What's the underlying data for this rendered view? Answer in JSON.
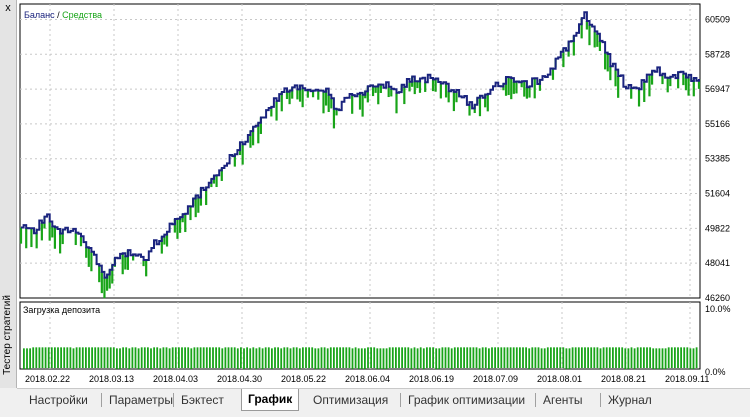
{
  "window": {
    "close_label": "x",
    "side_title": "Тестер стратегий"
  },
  "legend": {
    "balance": "Баланс",
    "separator": " / ",
    "equity": "Средства"
  },
  "colors": {
    "balance": "#1a237e",
    "equity": "#18a418",
    "deposit": "#18a418",
    "grid": "#c8c8c8"
  },
  "deposit_panel": {
    "title": "Загрузка депозита",
    "max_label": "10.0%",
    "min_label": "0.0%"
  },
  "chart_data": {
    "type": "line",
    "title": "",
    "series_names": [
      "Баланс",
      "Средства"
    ],
    "y_ticks": [
      "60509",
      "58728",
      "56947",
      "55166",
      "53385",
      "51604",
      "49822",
      "48041",
      "46260"
    ],
    "ylim": [
      46260,
      61300
    ],
    "x_labels": [
      "2018.02.22",
      "2018.03.13",
      "2018.04.03",
      "2018.04.30",
      "2018.05.22",
      "2018.06.04",
      "2018.06.19",
      "2018.07.09",
      "2018.08.01",
      "2018.08.21",
      "2018.09.11"
    ],
    "balance_curve": [
      [
        0,
        49800
      ],
      [
        0.02,
        49700
      ],
      [
        0.035,
        50500
      ],
      [
        0.045,
        50100
      ],
      [
        0.06,
        49600
      ],
      [
        0.075,
        49900
      ],
      [
        0.09,
        49400
      ],
      [
        0.11,
        48300
      ],
      [
        0.125,
        47300
      ],
      [
        0.14,
        48200
      ],
      [
        0.155,
        48600
      ],
      [
        0.17,
        48500
      ],
      [
        0.18,
        48000
      ],
      [
        0.195,
        49000
      ],
      [
        0.21,
        49500
      ],
      [
        0.23,
        50300
      ],
      [
        0.25,
        51000
      ],
      [
        0.27,
        51900
      ],
      [
        0.29,
        52600
      ],
      [
        0.31,
        53500
      ],
      [
        0.33,
        54300
      ],
      [
        0.35,
        55200
      ],
      [
        0.37,
        56200
      ],
      [
        0.39,
        56900
      ],
      [
        0.405,
        57100
      ],
      [
        0.42,
        56900
      ],
      [
        0.435,
        56700
      ],
      [
        0.45,
        56900
      ],
      [
        0.465,
        55900
      ],
      [
        0.48,
        56400
      ],
      [
        0.495,
        56700
      ],
      [
        0.51,
        56900
      ],
      [
        0.525,
        57000
      ],
      [
        0.54,
        57300
      ],
      [
        0.555,
        56900
      ],
      [
        0.575,
        57500
      ],
      [
        0.59,
        57300
      ],
      [
        0.605,
        57600
      ],
      [
        0.62,
        57200
      ],
      [
        0.635,
        56900
      ],
      [
        0.65,
        56500
      ],
      [
        0.665,
        56100
      ],
      [
        0.68,
        56600
      ],
      [
        0.695,
        57000
      ],
      [
        0.71,
        57300
      ],
      [
        0.725,
        57500
      ],
      [
        0.74,
        57200
      ],
      [
        0.755,
        57300
      ],
      [
        0.77,
        57500
      ],
      [
        0.785,
        58200
      ],
      [
        0.8,
        58900
      ],
      [
        0.815,
        59600
      ],
      [
        0.83,
        60700
      ],
      [
        0.845,
        60100
      ],
      [
        0.86,
        59000
      ],
      [
        0.875,
        57900
      ],
      [
        0.89,
        57200
      ],
      [
        0.905,
        56800
      ],
      [
        0.92,
        57400
      ],
      [
        0.935,
        58000
      ],
      [
        0.95,
        57500
      ],
      [
        0.965,
        57700
      ],
      [
        0.98,
        57600
      ],
      [
        1.0,
        57300
      ]
    ],
    "deposit_load": {
      "min": 0,
      "max": 10,
      "bar_level_percent": 3.8
    }
  },
  "tabs": [
    {
      "label": "Настройки"
    },
    {
      "label": "Параметры"
    },
    {
      "label": "Бэктест"
    },
    {
      "label": "График",
      "active": true
    },
    {
      "label": "Оптимизация"
    },
    {
      "label": "График оптимизации"
    },
    {
      "label": "Агенты"
    },
    {
      "label": "Журнал"
    }
  ]
}
